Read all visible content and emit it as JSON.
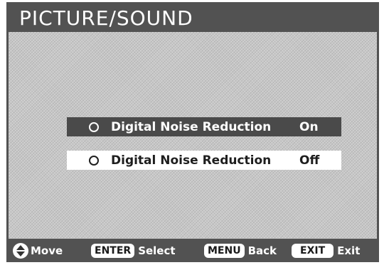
{
  "screen": {
    "title": "PICTURE/SOUND"
  },
  "menu": {
    "options": [
      {
        "label": "Digital Noise Reduction",
        "value": "On",
        "selected": true
      },
      {
        "label": "Digital Noise Reduction",
        "value": "Off",
        "selected": false
      }
    ]
  },
  "footer": {
    "move_icon": "up-down-arrows-icon",
    "move_label": "Move",
    "enter_key": "ENTER",
    "enter_label": "Select",
    "menu_key": "MENU",
    "menu_label": "Back",
    "exit_key": "EXIT",
    "exit_label": "Exit"
  },
  "colors": {
    "frame": "#525252",
    "content_bg": "#c7c7c7",
    "selected_bg": "#4a4a4a",
    "option_bg": "#ffffff"
  }
}
